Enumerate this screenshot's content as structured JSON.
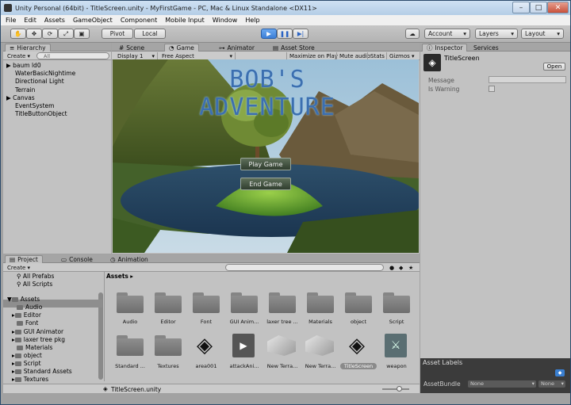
{
  "window": {
    "title": "Unity Personal (64bit) - TitleScreen.unity - MyFirstGame - PC, Mac & Linux Standalone <DX11>"
  },
  "menu": [
    "File",
    "Edit",
    "Assets",
    "GameObject",
    "Component",
    "Mobile Input",
    "Window",
    "Help"
  ],
  "toolbar": {
    "pivot": "Pivot",
    "local": "Local",
    "account": "Account",
    "layers": "Layers",
    "layout": "Layout"
  },
  "hierarchy": {
    "tab": "Hierarchy",
    "create": "Create",
    "search_placeholder": "All",
    "items": [
      "baum ld0",
      "WaterBasicNightime",
      "Directional Light",
      "Terrain",
      "Canvas",
      "EventSystem",
      "TitleButtonObject"
    ]
  },
  "center_tabs": {
    "scene": "Scene",
    "game": "Game",
    "animator": "Animator",
    "asset_store": "Asset Store"
  },
  "game_bar": {
    "display": "Display 1",
    "aspect": "Free Aspect",
    "maximize": "Maximize on Play",
    "mute": "Mute audio",
    "stats": "Stats",
    "gizmos": "Gizmos"
  },
  "game_view": {
    "title": "BOB'S ADVENTURE",
    "play_button": "Play Game",
    "end_button": "End Game"
  },
  "inspector": {
    "tab": "Inspector",
    "services_tab": "Services",
    "object_name": "TitleScreen",
    "open": "Open",
    "message_label": "Message",
    "warning_label": "Is Warning"
  },
  "project": {
    "tab_project": "Project",
    "tab_console": "Console",
    "tab_animation": "Animation",
    "create": "Create",
    "favorites": [
      "All Prefabs",
      "All Scripts"
    ],
    "tree_root": "Assets",
    "tree": [
      "Audio",
      "Editor",
      "Font",
      "GUI Animator",
      "laxer tree pkg",
      "Materials",
      "object",
      "Script",
      "Standard Assets",
      "Textures"
    ],
    "breadcrumb": "Assets",
    "assets_row1": [
      "Audio",
      "Editor",
      "Font",
      "GUI Anim...",
      "laxer tree ...",
      "Materials",
      "object",
      "Script"
    ],
    "assets_row2": [
      "Standard ...",
      "Textures",
      "area001",
      "attackAni...",
      "New Terra...",
      "New Terra...",
      "TitleScreen",
      "weapon"
    ],
    "footer": "TitleScreen.unity"
  },
  "asset_labels": {
    "title": "Asset Labels",
    "bundle_label": "AssetBundle",
    "bundle_value": "None",
    "variant_value": "None"
  }
}
